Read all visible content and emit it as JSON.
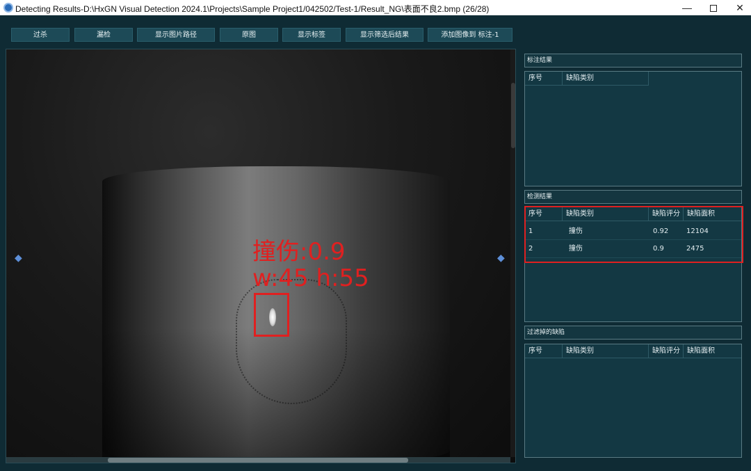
{
  "window": {
    "title": "Detecting Results-D:\\HxGN Visual Detection 2024.1\\Projects\\Sample Project1/042502/Test-1/Result_NG\\表面不良2.bmp  (26/28)",
    "minimize": "—",
    "close": "✕"
  },
  "toolbar": {
    "btn1": "过杀",
    "btn2": "漏检",
    "btn3": "显示图片路径",
    "btn4": "原图",
    "btn5": "显示标签",
    "btn6": "显示筛选后结果",
    "btn7": "添加图像到 标注-1"
  },
  "viewer": {
    "overlay_label_line1": "撞伤:0.9",
    "overlay_label_line2": "w:45 h:55",
    "prev_icon": "◆",
    "next_icon": "◆",
    "overlay_color": "#e02020"
  },
  "annotation_panel": {
    "title": "标注结果",
    "columns": [
      "序号",
      "缺陷类别"
    ]
  },
  "detection_panel": {
    "title": "检测结果",
    "columns": [
      "序号",
      "缺陷类别",
      "缺陷评分",
      "缺陷面积"
    ],
    "rows": [
      [
        "1",
        "撞伤",
        "0.92",
        "12104"
      ],
      [
        "2",
        "撞伤",
        "0.9",
        "2475"
      ]
    ]
  },
  "filtered_panel": {
    "title": "过滤掉的缺陷",
    "columns": [
      "序号",
      "缺陷类别",
      "缺陷评分",
      "缺陷面积"
    ]
  }
}
